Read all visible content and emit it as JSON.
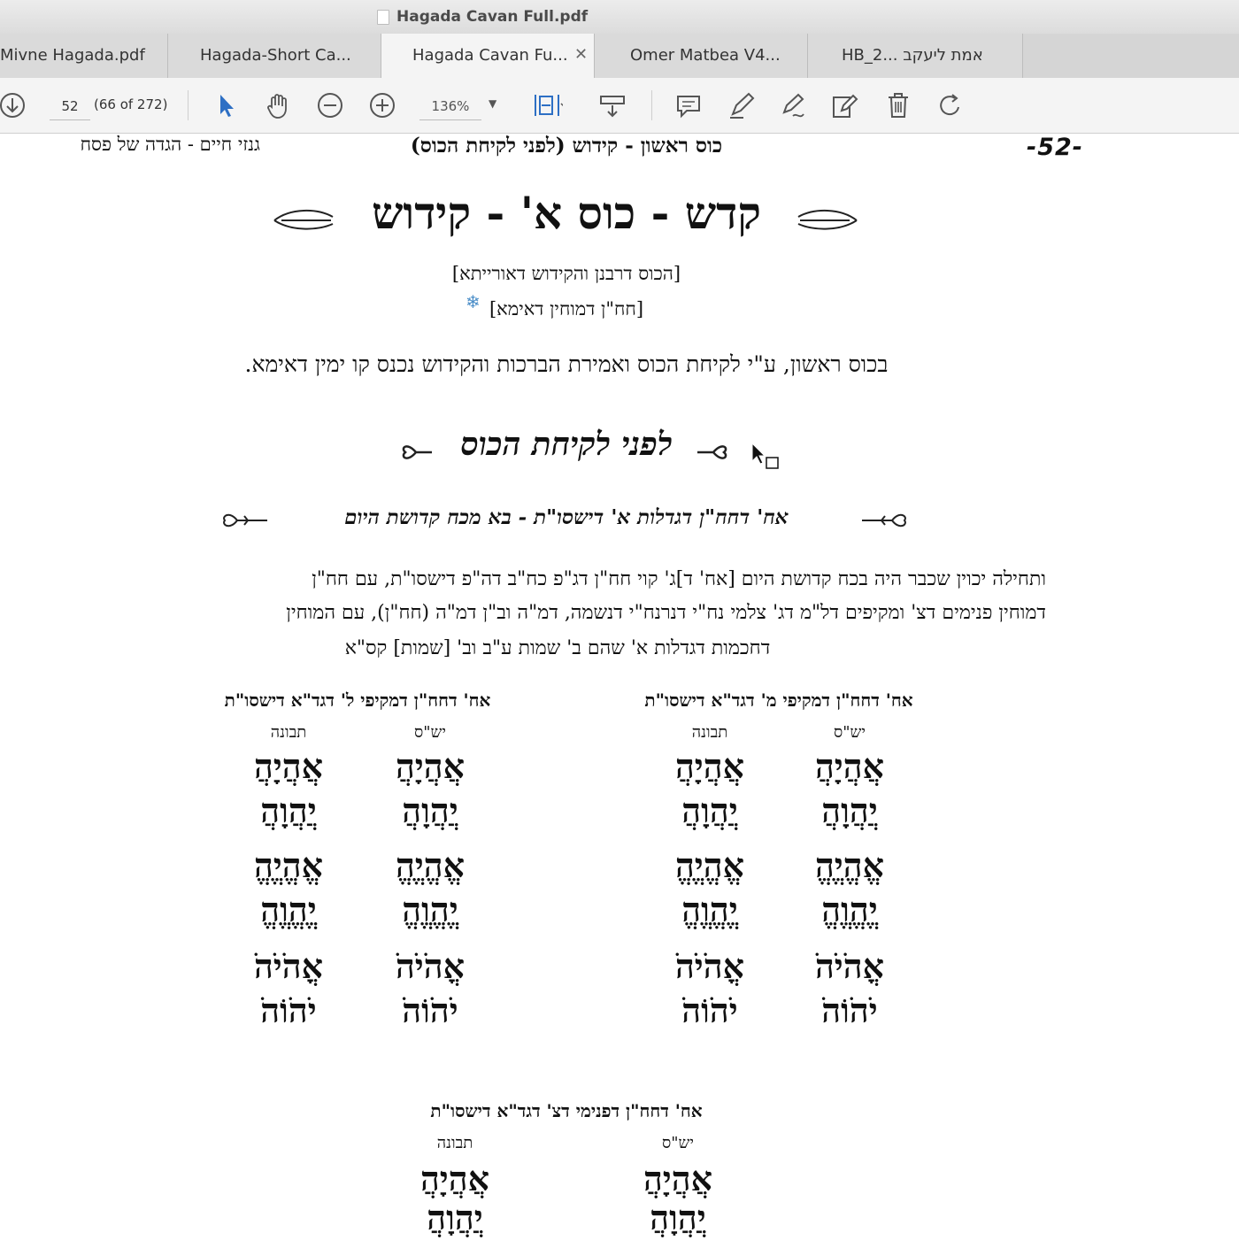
{
  "window": {
    "title": "Hagada Cavan Full.pdf"
  },
  "tabs": [
    {
      "label": "Mivne Hagada.pdf",
      "active": false,
      "closable": false
    },
    {
      "label": "Hagada-Short Ca...",
      "active": false,
      "closable": false
    },
    {
      "label": "Hagada Cavan Fu...",
      "active": true,
      "closable": true
    },
    {
      "label": "Omer Matbea V4...",
      "active": false,
      "closable": false
    },
    {
      "label": "HB_2... אמת ליעקב",
      "active": false,
      "closable": false
    }
  ],
  "toolbar": {
    "page_value": "52",
    "page_count": "(66 of 272)",
    "zoom_value": "136%",
    "icons": [
      "download-icon",
      "select-arrow-icon",
      "hand-icon",
      "zoom-out-icon",
      "zoom-in-icon",
      "fit-page-icon",
      "scroll-mode-icon",
      "comment-icon",
      "highlight-icon",
      "sign-icon",
      "edit-icon",
      "delete-icon",
      "rotate-icon"
    ]
  },
  "page": {
    "header_right": "גנזי חיים - הגדה של פסח",
    "header_center": "כוס ראשון - קידוש (לפני לקיחת הכוס)",
    "page_number": "-52-",
    "main_title": "קדש - כוס א' - קידוש",
    "subtitle_1": "[הכוס דרבנן והקידוש דאורייתא]",
    "subtitle_2": "[חח\"ן דמוחין דאימא]",
    "intro": "בכוס ראשון, ע\"י לקיחת הכוס ואמירת הברכות והקידוש נכנס קו ימין דאימא.",
    "section_title": "לפני לקיחת הכוס",
    "section_subtitle": "אח' דחח\"ן דגדלות א' דישסו\"ת - בא מכח קדושת היום",
    "body_line_1": "ותחילה יכוין שכבר היה בכח קדושת היום [אח' ד]ג' קוי חח\"ן דג\"פ כח\"ב דה\"פ דישסו\"ת, עם חח\"ן",
    "body_line_2": "דמוחין פנימים דצ' ומקיפים דל\"מ דג' צלמי נח\"י דנרנח\"י דנשמה, דמ\"ה וב\"ן דמ\"ה (חח\"ן), עם המוחין",
    "body_line_3": "דחכמות דגדלות א' שהם ב' שמות ע\"ב וב' [שמות] קס\"א",
    "groups": [
      {
        "heading": "אח' דחח\"ן דמקיפי מ' דגד\"א דישסו\"ת",
        "col_right": "יש\"ס",
        "col_left": "תבונה",
        "names": [
          "אֲהֲיָהֲ",
          "יֲהֲוָהֲ",
          "אֱהֱיֱהֱ",
          "יֱהֱוֱהֱ",
          "אֳהֹיֹהֹ",
          "יֹהֹוֹהֹ"
        ]
      },
      {
        "heading": "אח' דחח\"ן דמקיפי ל' דגד\"א דישסו\"ת",
        "col_right": "יש\"ס",
        "col_left": "תבונה",
        "names": [
          "אֲהֲיָהֲ",
          "יֲהֲוָהֲ",
          "אֱהֱיֱהֱ",
          "יֱהֱוֱהֱ",
          "אֳהֹיֹהֹ",
          "יֹהֹוֹהֹ"
        ]
      },
      {
        "heading": "אח' דחח\"ן דפנימי דצ' דגד\"א דישסו\"ת",
        "col_right": "יש\"ס",
        "col_left": "תבונה",
        "names": [
          "אֲהֲיָהֲ",
          "יֲהֲוָהֲ"
        ]
      }
    ]
  },
  "colors": {
    "accent_blue": "#2d6fc4",
    "snowflake": "#4b8ec8"
  }
}
